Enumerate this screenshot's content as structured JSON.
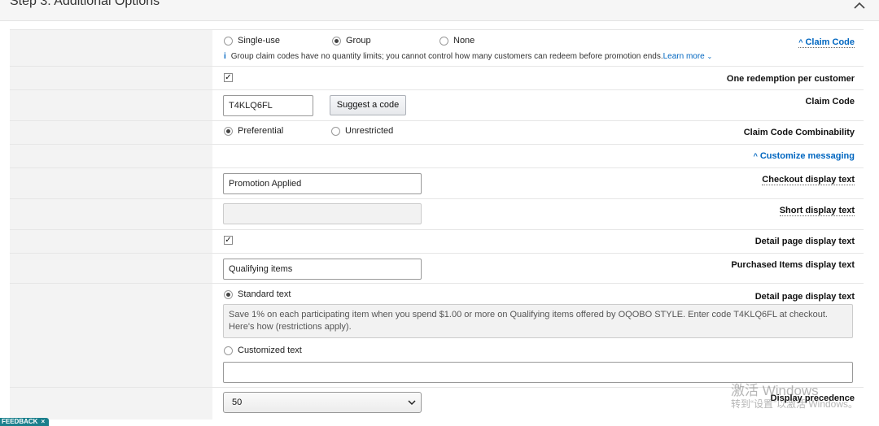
{
  "step": {
    "title": "Step 3: Additional Options"
  },
  "claim_code_type": {
    "label": "Claim Code",
    "options": [
      "Single-use",
      "Group",
      "None"
    ],
    "selected": "Group",
    "info": "Group claim codes have no quantity limits; you cannot control how many customers can redeem before promotion ends.",
    "info_icon": "i",
    "learn_more": "Learn more"
  },
  "one_redemption": {
    "label": "One redemption per customer",
    "checked": true
  },
  "claim_code": {
    "label": "Claim Code",
    "value": "T4KLQ6FL",
    "suggest_button": "Suggest a code"
  },
  "combinability": {
    "label": "Claim Code Combinability",
    "options": [
      "Preferential",
      "Unrestricted"
    ],
    "selected": "Preferential"
  },
  "customize_messaging": {
    "label": "Customize messaging"
  },
  "checkout_display": {
    "label": "Checkout display text",
    "value": "Promotion Applied"
  },
  "short_display": {
    "label": "Short display text",
    "value": ""
  },
  "detail_page_check": {
    "label": "Detail page display text",
    "checked": true
  },
  "purchased_items": {
    "label": "Purchased Items display text",
    "value": "Qualifying items"
  },
  "detail_page_text": {
    "label": "Detail page display text",
    "standard_option": "Standard text",
    "standard_value": "Save 1% on each participating item when you spend $1.00 or more on Qualifying items offered by OQOBO STYLE. Enter code T4KLQ6FL at checkout. Here's how (restrictions apply).",
    "custom_option": "Customized text",
    "custom_value": "",
    "selected": "Standard text"
  },
  "display_precedence": {
    "label": "Display precedence",
    "value": "50"
  },
  "watermark": {
    "line1": "激活 Windows",
    "line2": "转到“设置”以激活 Windows。"
  },
  "feedback": {
    "label": "FEEDBACK",
    "close": "×"
  }
}
